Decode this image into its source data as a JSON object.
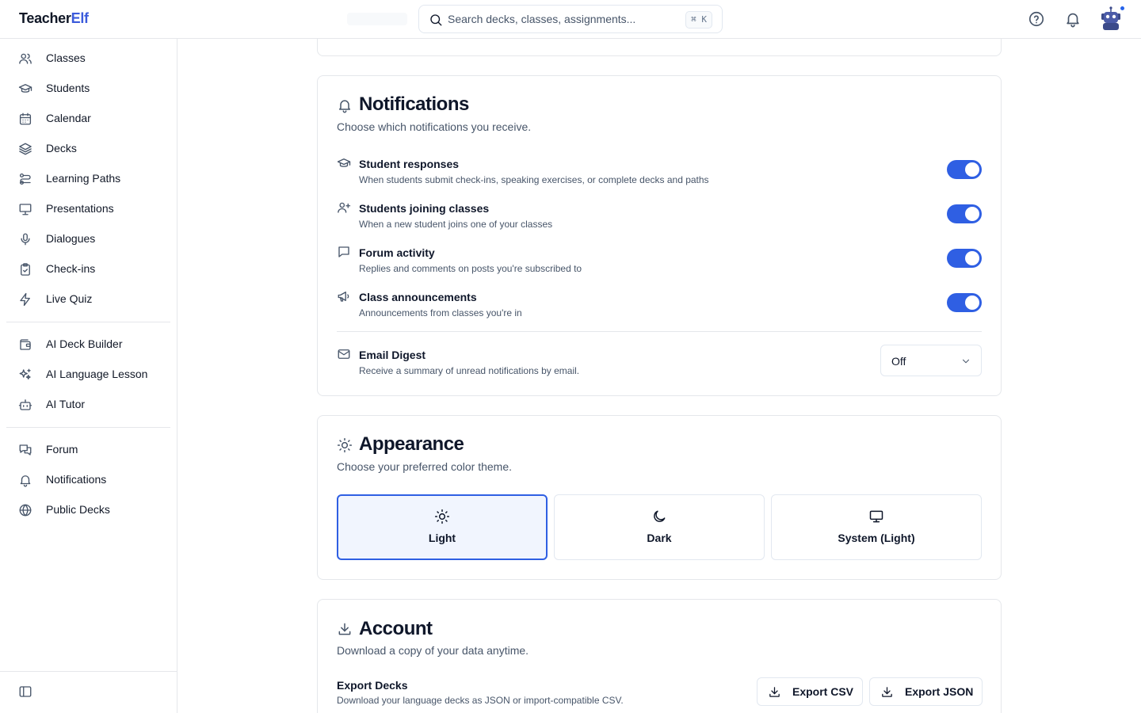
{
  "app": {
    "logo_part1": "Teacher",
    "logo_part2": "Elf"
  },
  "search": {
    "placeholder": "Search decks, classes, assignments...",
    "shortcut": "⌘ K"
  },
  "sidebar": {
    "group1": [
      {
        "label": "Classes",
        "icon": "users-icon"
      },
      {
        "label": "Students",
        "icon": "graduation-cap-icon"
      },
      {
        "label": "Calendar",
        "icon": "calendar-icon"
      },
      {
        "label": "Decks",
        "icon": "layers-icon"
      },
      {
        "label": "Learning Paths",
        "icon": "route-icon"
      },
      {
        "label": "Presentations",
        "icon": "presentation-icon"
      },
      {
        "label": "Dialogues",
        "icon": "microphone-icon"
      },
      {
        "label": "Check-ins",
        "icon": "clipboard-check-icon"
      },
      {
        "label": "Live Quiz",
        "icon": "lightning-icon"
      }
    ],
    "group2": [
      {
        "label": "AI Deck Builder",
        "icon": "wallet-icon"
      },
      {
        "label": "AI Language Lesson",
        "icon": "sparkles-icon"
      },
      {
        "label": "AI Tutor",
        "icon": "bot-icon"
      }
    ],
    "group3": [
      {
        "label": "Forum",
        "icon": "messages-icon"
      },
      {
        "label": "Notifications",
        "icon": "bell-icon"
      },
      {
        "label": "Public Decks",
        "icon": "globe-icon"
      }
    ]
  },
  "notifications": {
    "title": "Notifications",
    "subtitle": "Choose which notifications you receive.",
    "items": [
      {
        "title": "Student responses",
        "desc": "When students submit check-ins, speaking exercises, or complete decks and paths",
        "enabled": true
      },
      {
        "title": "Students joining classes",
        "desc": "When a new student joins one of your classes",
        "enabled": true
      },
      {
        "title": "Forum activity",
        "desc": "Replies and comments on posts you're subscribed to",
        "enabled": true
      },
      {
        "title": "Class announcements",
        "desc": "Announcements from classes you're in",
        "enabled": true
      }
    ],
    "email_digest": {
      "title": "Email Digest",
      "desc": "Receive a summary of unread notifications by email.",
      "value": "Off"
    }
  },
  "appearance": {
    "title": "Appearance",
    "subtitle": "Choose your preferred color theme.",
    "options": [
      {
        "label": "Light",
        "icon": "sun-icon",
        "selected": true
      },
      {
        "label": "Dark",
        "icon": "moon-icon",
        "selected": false
      },
      {
        "label": "System (Light)",
        "icon": "monitor-icon",
        "selected": false
      }
    ]
  },
  "account": {
    "title": "Account",
    "subtitle": "Download a copy of your data anytime.",
    "export_title": "Export Decks",
    "export_desc": "Download your language decks as JSON or import-compatible CSV.",
    "export_csv_label": "Export CSV",
    "export_json_label": "Export JSON"
  },
  "colors": {
    "accent": "#2f5fe3",
    "brand": "#3b5bdb",
    "notification_dot": "#2563eb"
  }
}
